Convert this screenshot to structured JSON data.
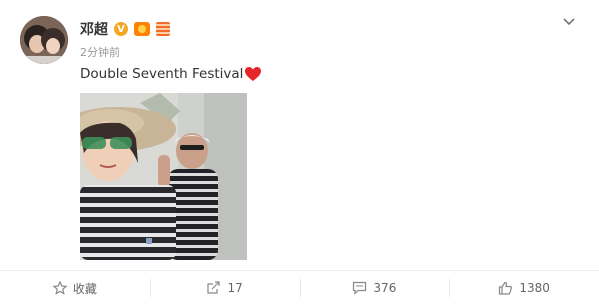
{
  "post": {
    "author": "邓超",
    "time": "2分钟前",
    "text": "Double Seventh Festival",
    "text_emoji": "heart",
    "photo_description": "selfie",
    "badges": [
      "verified-v-badge",
      "member-badge",
      "vip-badge"
    ]
  },
  "actions": {
    "favorite_label": "收藏",
    "repost_count": "17",
    "comment_count": "376",
    "like_count": "1380"
  },
  "colors": {
    "text": "#333333",
    "muted": "#999999",
    "action_text": "#666666",
    "verified": "#f5a623",
    "heart": "#e6272a"
  }
}
